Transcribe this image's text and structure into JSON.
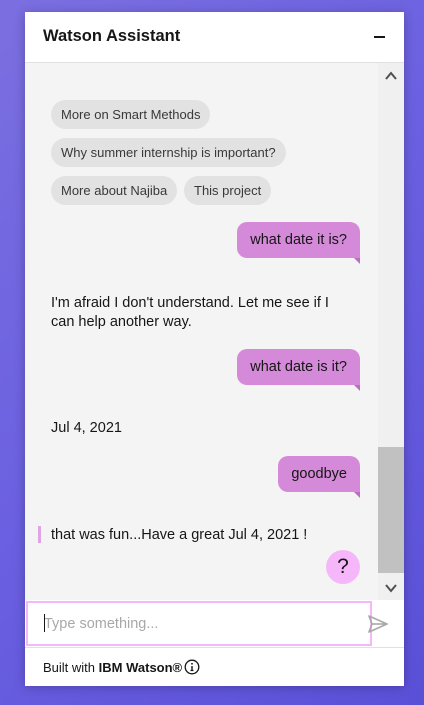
{
  "header": {
    "title": "Watson Assistant"
  },
  "chips": [
    {
      "label": "More on Smart Methods"
    },
    {
      "label": "Why summer internship is important?"
    },
    {
      "label": "More about Najiba"
    },
    {
      "label": "This project"
    }
  ],
  "messages": [
    {
      "from": "user",
      "text": "what date it is?"
    },
    {
      "from": "bot",
      "text": "I'm afraid I don't understand. Let me see if I can help another way."
    },
    {
      "from": "user",
      "text": "what date is it?"
    },
    {
      "from": "bot",
      "text": "Jul 4, 2021"
    },
    {
      "from": "user",
      "text": "goodbye"
    },
    {
      "from": "bot",
      "text": "that was fun...Have a great Jul 4, 2021 !"
    }
  ],
  "help_button": {
    "label": "?"
  },
  "input": {
    "placeholder": "Type something...",
    "value": ""
  },
  "footer": {
    "prefix": "Built with",
    "brand": "IBM Watson®"
  },
  "icons": {
    "minimize": "minimize-icon",
    "send": "send-icon",
    "info": "info-icon",
    "scroll_up": "chevron-up-icon",
    "scroll_down": "chevron-down-icon"
  },
  "colors": {
    "user_bubble": "#d48ad8",
    "accent": "#f6b7fa",
    "chip_bg": "#e2e2e2"
  }
}
